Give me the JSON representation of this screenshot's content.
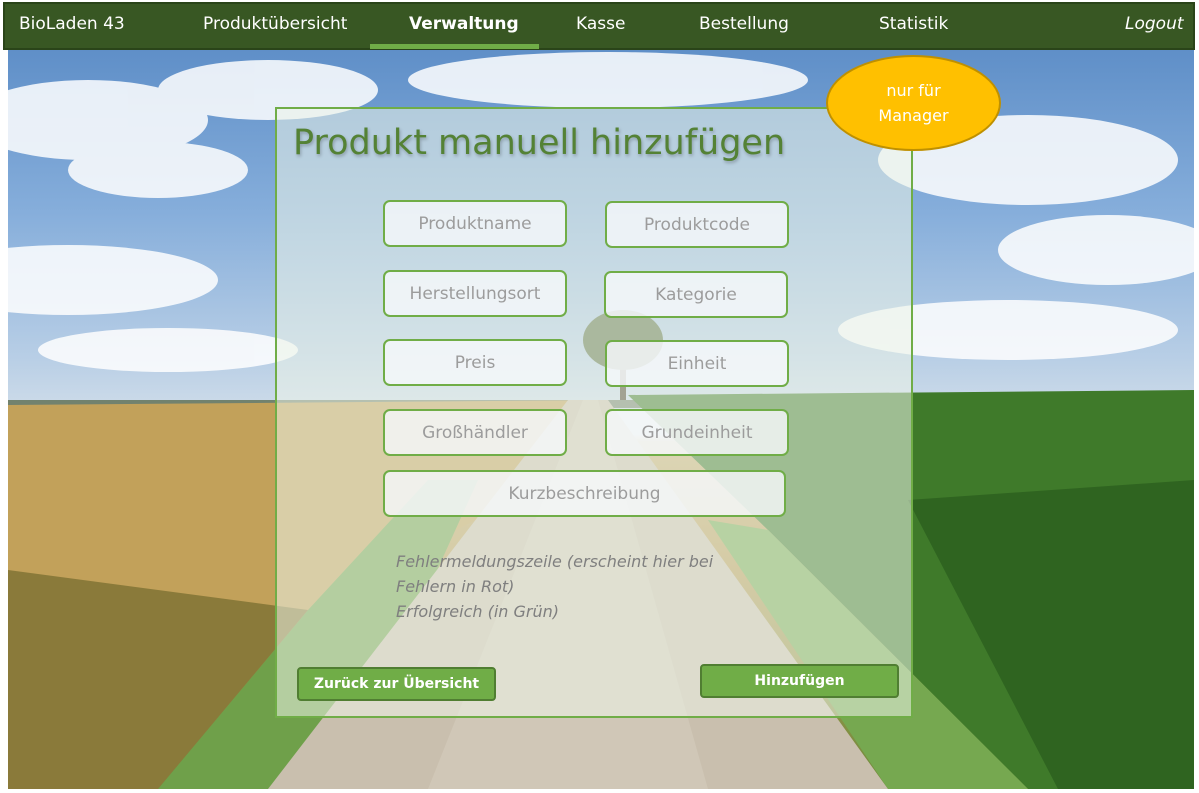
{
  "nav": {
    "brand": "BioLaden 43",
    "items": [
      {
        "label": "Produktübersicht"
      },
      {
        "label": "Verwaltung"
      },
      {
        "label": "Kasse"
      },
      {
        "label": "Bestellung"
      },
      {
        "label": "Statistik"
      }
    ],
    "logout": "Logout"
  },
  "badge": {
    "line1": "nur für",
    "line2": "Manager"
  },
  "form": {
    "title": "Produkt manuell hinzufügen",
    "fields": {
      "produktname": "Produktname",
      "produktcode": "Produktcode",
      "herstellungsort": "Herstellungsort",
      "kategorie": "Kategorie",
      "preis": "Preis",
      "einheit": "Einheit",
      "grosshaendler": "Großhändler",
      "grundeinheit": "Grundeinheit",
      "kurzbeschreibung": "Kurzbeschreibung"
    },
    "message": {
      "error": "Fehlermeldungszeile (erscheint hier bei Fehlern in Rot)",
      "success": "Erfolgreich (in Grün)"
    },
    "back_button": "Zurück zur Übersicht",
    "add_button": "Hinzufügen"
  },
  "colors": {
    "nav_bg": "#385723",
    "accent": "#70ad47",
    "title": "#548235",
    "badge": "#ffc000"
  }
}
